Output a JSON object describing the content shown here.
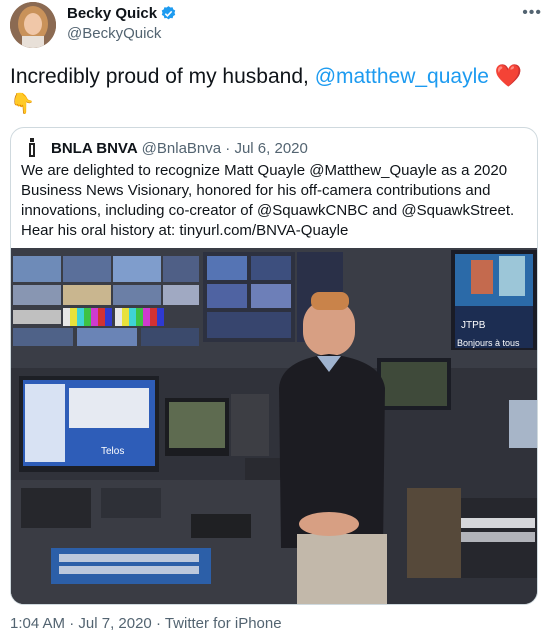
{
  "author": {
    "name": "Becky Quick",
    "handle": "@BeckyQuick"
  },
  "tweet": {
    "text_before": "Incredibly proud of my husband, ",
    "mention": "@matthew_quayle",
    "emoji_heart": "❤️",
    "emoji_pointer": "👇"
  },
  "quoted": {
    "name": "BNLA BNVA",
    "handle": "@BnlaBnva",
    "separator": " · ",
    "date": "Jul 6, 2020",
    "text": "We are delighted to recognize Matt Quayle @Matthew_Quayle as a 2020 Business News Visionary, honored for his off-camera contributions and innovations, including co-creator of @SquawkCNBC and @SquawkStreet. Hear his oral history at: tinyurl.com/BNVA-Quayle",
    "photo_screen_text_1": "JTPB",
    "photo_screen_text_2": "Bonjours à tous",
    "photo_monitor_text": "Telos"
  },
  "footer": {
    "time": "1:04 AM",
    "separator": " · ",
    "date": "Jul 7, 2020",
    "source": "Twitter for iPhone"
  },
  "colors": {
    "link": "#1d9bf0",
    "secondary_text": "#536471",
    "verified": "#1d9bf0"
  },
  "icons": {
    "verified": "verified-badge-icon",
    "more": "more-horizontal-icon"
  }
}
